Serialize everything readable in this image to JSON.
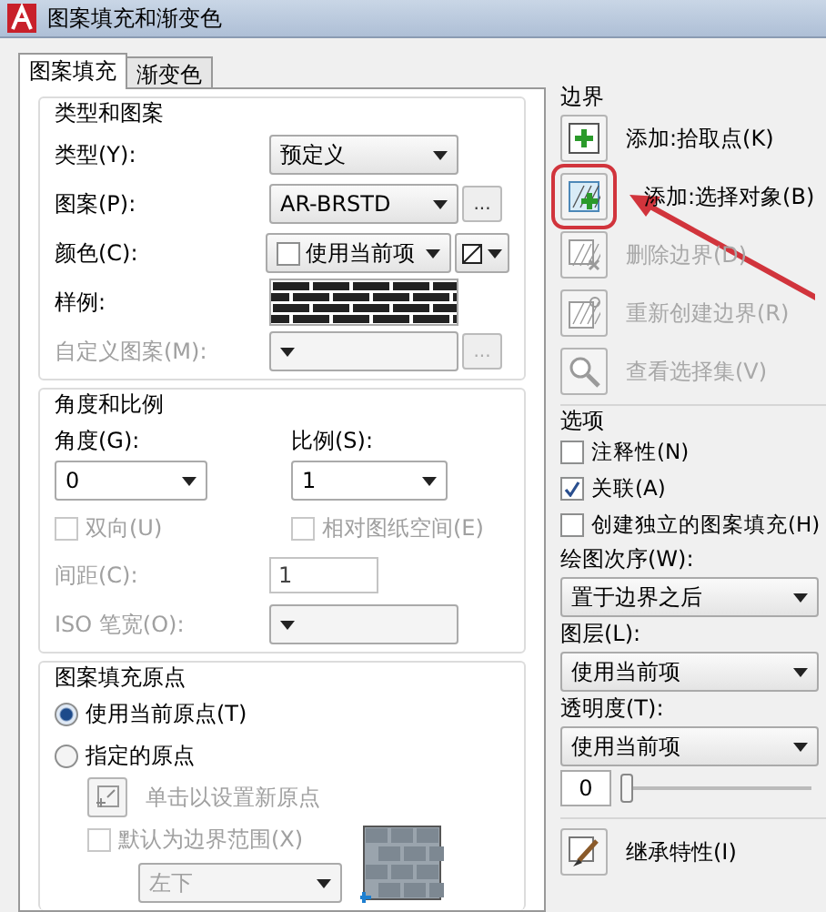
{
  "window": {
    "title": "图案填充和渐变色"
  },
  "tabs": [
    {
      "label": "图案填充",
      "selected": true
    },
    {
      "label": "渐变色",
      "selected": false
    }
  ],
  "type_and_pattern": {
    "title": "类型和图案",
    "rows": [
      {
        "kind": "select",
        "label": "类型(Y):",
        "value": "预定义",
        "disabled": false
      },
      {
        "kind": "select",
        "label": "图案(P):",
        "value": "AR-BRSTD",
        "disabled": false,
        "browse": "..."
      },
      {
        "kind": "color",
        "label": "颜色(C):",
        "value": "使用当前项",
        "disabled": false
      },
      {
        "kind": "swatch",
        "label": "样例:",
        "disabled": false
      },
      {
        "kind": "select",
        "label": "自定义图案(M):",
        "disabled": true,
        "browse": "..."
      }
    ]
  },
  "angle_scale": {
    "title": "角度和比例",
    "angle": {
      "label": "角度(G):",
      "value": "0"
    },
    "scale": {
      "label": "比例(S):",
      "value": "1"
    },
    "checks": [
      {
        "label": "双向(U)",
        "checked": false,
        "disabled": true
      },
      {
        "label": "相对图纸空间(E)",
        "checked": false,
        "disabled": true
      }
    ],
    "spacing": {
      "label": "间距(C):",
      "value": "1",
      "disabled": true
    },
    "iso": {
      "label": "ISO 笔宽(O):",
      "disabled": true
    }
  },
  "origin": {
    "title": "图案填充原点",
    "radios": [
      {
        "label": "使用当前原点(T)",
        "selected": true
      },
      {
        "label": "指定的原点",
        "selected": false
      }
    ],
    "click_button": {
      "label": "单击以设置新原点",
      "disabled": true
    },
    "default_extent": {
      "label": "默认为边界范围(X)",
      "checked": false,
      "disabled": true
    },
    "position": {
      "value": "左下",
      "disabled": true
    }
  },
  "boundaries": {
    "title": "边界",
    "buttons": [
      {
        "kind": "pick",
        "label": "添加:拾取点(K)",
        "disabled": false,
        "highlighted": false
      },
      {
        "kind": "select",
        "label": "添加:选择对象(B)",
        "disabled": false,
        "highlighted": true
      },
      {
        "kind": "remove",
        "label": "删除边界(D)",
        "disabled": true,
        "highlighted": false
      },
      {
        "kind": "recreate",
        "label": "重新创建边界(R)",
        "disabled": true,
        "highlighted": false
      },
      {
        "kind": "view",
        "label": "查看选择集(V)",
        "disabled": true,
        "highlighted": false
      }
    ]
  },
  "options": {
    "title": "选项",
    "checks": [
      {
        "label": "注释性(N)",
        "checked": false
      },
      {
        "label": "关联(A)",
        "checked": true
      },
      {
        "label": "创建独立的图案填充(H)",
        "checked": false
      }
    ],
    "selects": [
      {
        "label": "绘图次序(W):",
        "value": "置于边界之后"
      },
      {
        "label": "图层(L):",
        "value": "使用当前项"
      },
      {
        "label": "透明度(T):",
        "value": "使用当前项"
      }
    ],
    "transparency": {
      "value": "0",
      "level": 0
    }
  },
  "inherit": {
    "label": "继承特性(I)"
  }
}
